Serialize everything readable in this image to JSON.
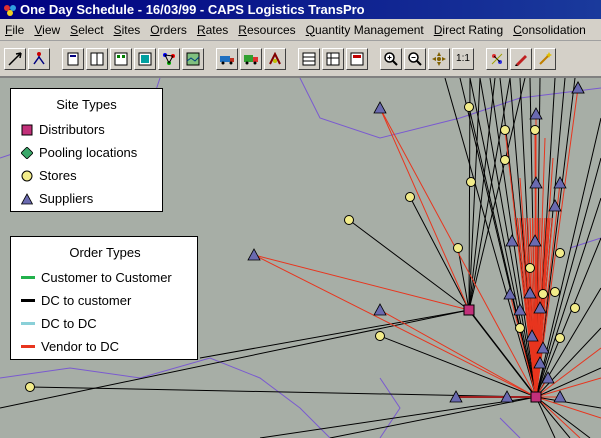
{
  "window": {
    "title": "One Day Schedule - 16/03/99 - CAPS Logistics TransPro"
  },
  "menu": {
    "items": [
      {
        "label": "File",
        "ul": "F",
        "rest": "ile"
      },
      {
        "label": "View",
        "ul": "V",
        "rest": "iew"
      },
      {
        "label": "Select",
        "ul": "S",
        "rest": "elect"
      },
      {
        "label": "Sites",
        "ul": "S",
        "rest": "ites"
      },
      {
        "label": "Orders",
        "ul": "O",
        "rest": "rders"
      },
      {
        "label": "Rates",
        "ul": "R",
        "rest": "ates"
      },
      {
        "label": "Resources",
        "ul": "R",
        "rest": "esources"
      },
      {
        "label": "Quantity Management",
        "ul": "Q",
        "rest": "uantity Management"
      },
      {
        "label": "Direct Rating",
        "ul": "D",
        "rest": "irect Rating"
      },
      {
        "label": "Consolidation",
        "ul": "C",
        "rest": "onsolidation"
      }
    ]
  },
  "toolbar": {
    "zoom_ratio_label": "1:1"
  },
  "site_legend": {
    "title": "Site Types",
    "items": [
      {
        "label": "Distributors",
        "symbol": "square",
        "color": "#c2307a"
      },
      {
        "label": "Pooling locations",
        "symbol": "diamond",
        "color": "#3aa86a"
      },
      {
        "label": "Stores",
        "symbol": "circle",
        "color": "#f2ec8a"
      },
      {
        "label": "Suppliers",
        "symbol": "triangle",
        "color": "#6a6ab0"
      }
    ]
  },
  "order_legend": {
    "title": "Order Types",
    "items": [
      {
        "label": "Customer to Customer",
        "color": "#22b14c"
      },
      {
        "label": "DC to customer",
        "color": "#000000"
      },
      {
        "label": "DC to DC",
        "color": "#8ad0d8"
      },
      {
        "label": "Vendor to DC",
        "color": "#e8351e"
      }
    ]
  },
  "colors": {
    "map_background": "#a7aea6",
    "region_border": "#7a5ad0",
    "titlebar": "#000080"
  }
}
